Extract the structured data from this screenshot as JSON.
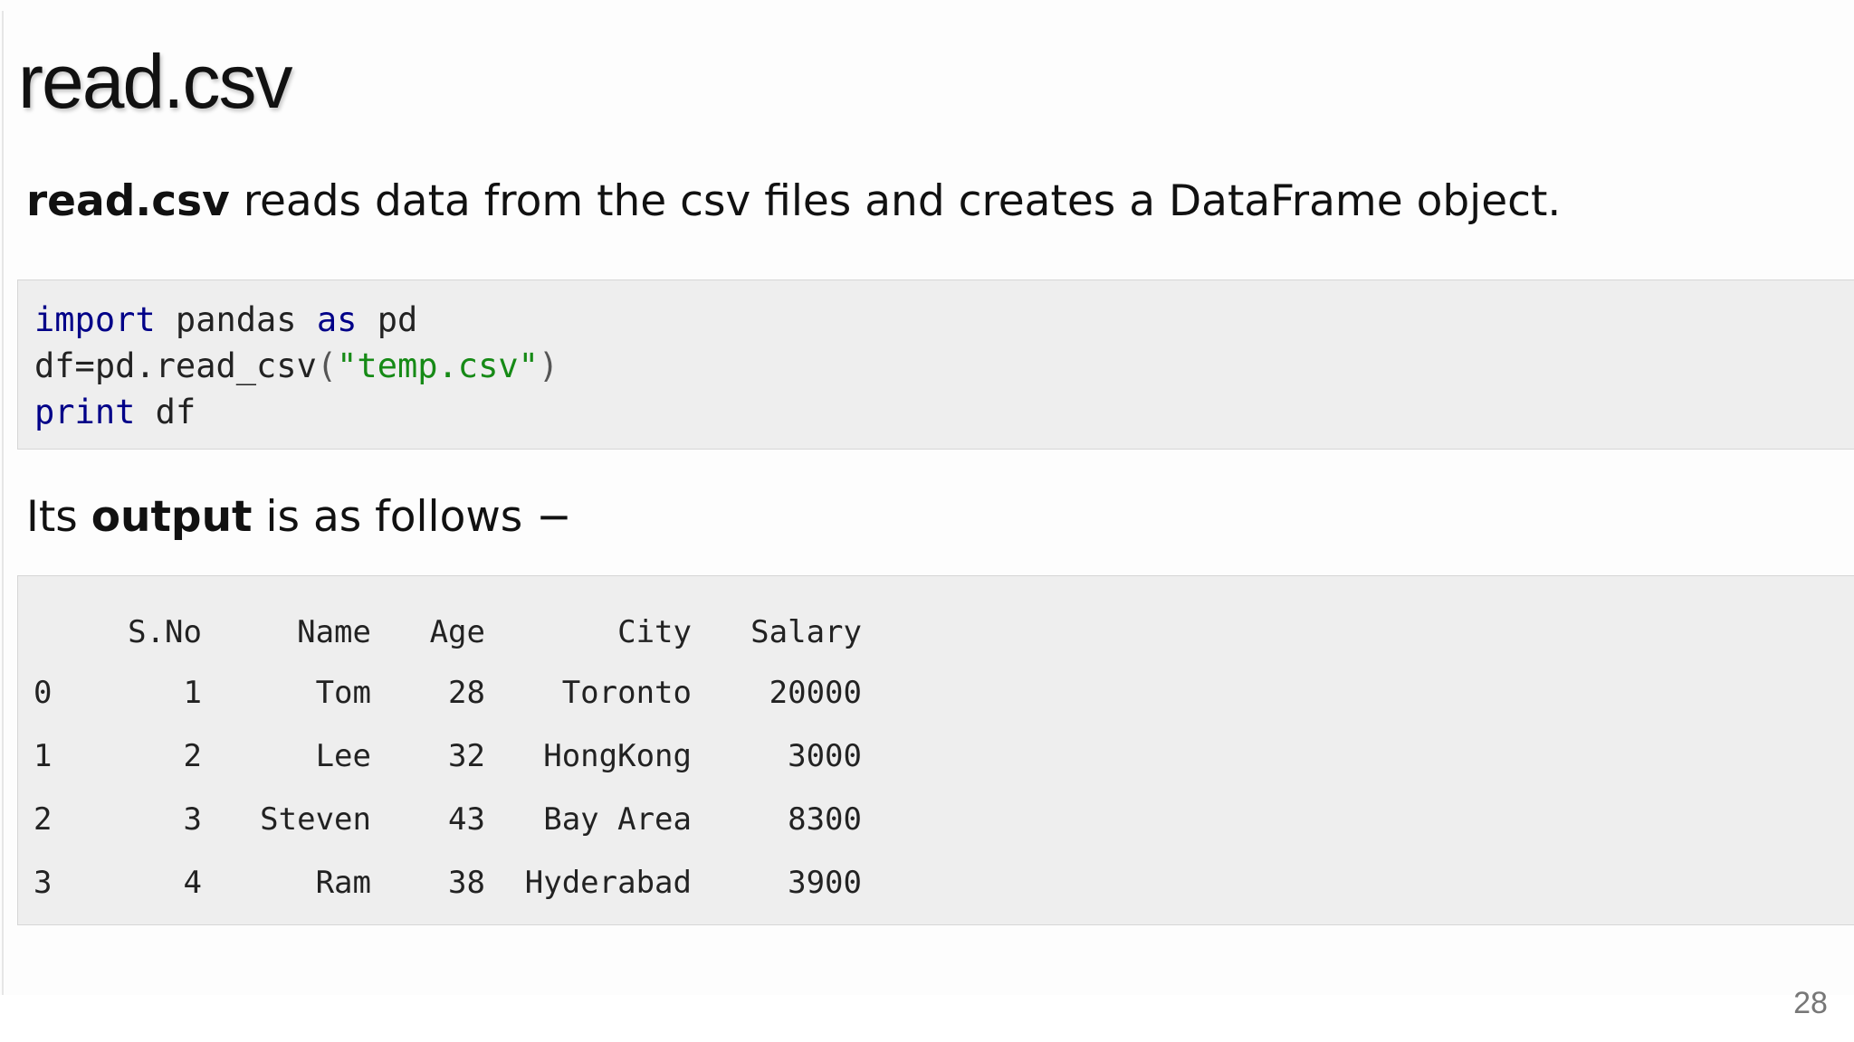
{
  "slide": {
    "title": "read.csv",
    "intro": {
      "bold": "read.csv",
      "text": " reads data from the csv files and creates a DataFrame object."
    },
    "code": {
      "line1": {
        "kw1": "import",
        "mid": " pandas ",
        "kw2": "as",
        "end": " pd"
      },
      "line2": {
        "start": "df=pd.read_csv",
        "open": "(",
        "str": "\"temp.csv\"",
        "close": ")"
      },
      "line3": {
        "kw": "print",
        "end": " df"
      }
    },
    "output_intro": {
      "before": "Its ",
      "bold": "output",
      "after": " is as follows −"
    },
    "table": {
      "headers": [
        "",
        "S.No",
        "Name",
        "Age",
        "City",
        "Salary"
      ],
      "rows": [
        [
          "0",
          "1",
          "Tom",
          "28",
          "Toronto",
          "20000"
        ],
        [
          "1",
          "2",
          "Lee",
          "32",
          "HongKong",
          "3000"
        ],
        [
          "2",
          "3",
          "Steven",
          "43",
          "Bay Area",
          "8300"
        ],
        [
          "3",
          "4",
          "Ram",
          "38",
          "Hyderabad",
          "3900"
        ]
      ]
    },
    "page_number": "28"
  }
}
